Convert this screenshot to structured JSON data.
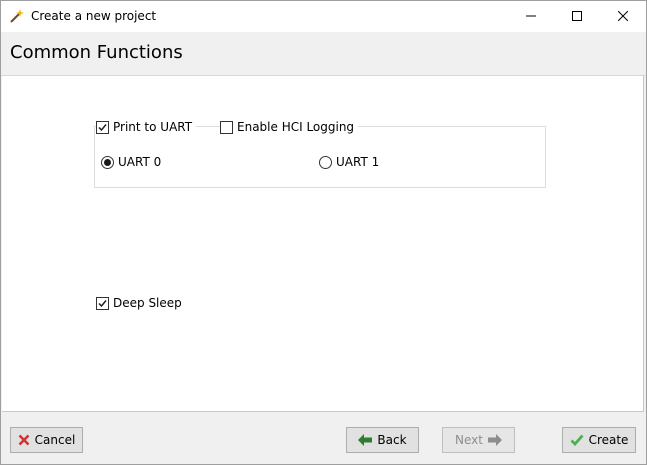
{
  "window": {
    "title": "Create a new project",
    "icon": "magic-wand-icon"
  },
  "header": {
    "title": "Common Functions"
  },
  "content": {
    "print_to_uart": {
      "label": "Print to UART",
      "checked": true
    },
    "enable_hci_logging": {
      "label": "Enable HCI Logging",
      "checked": false
    },
    "uart_options": [
      {
        "label": "UART 0",
        "selected": true
      },
      {
        "label": "UART 1",
        "selected": false
      }
    ],
    "deep_sleep": {
      "label": "Deep Sleep",
      "checked": true
    }
  },
  "footer": {
    "cancel_label": "Cancel",
    "back_label": "Back",
    "next_label": "Next",
    "create_label": "Create"
  },
  "colors": {
    "cancel_icon": "#d32f2f",
    "arrow_enabled": "#2e7d32",
    "arrow_disabled": "#8d8d8d",
    "create_check": "#4caf50"
  }
}
